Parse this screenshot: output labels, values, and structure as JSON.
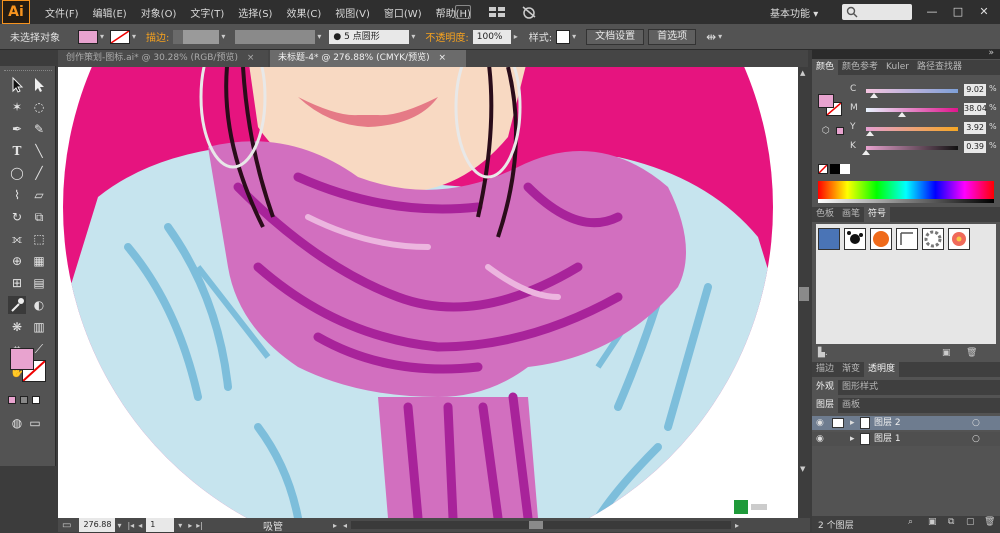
{
  "app": {
    "logo": "Ai"
  },
  "menu": [
    "文件(F)",
    "编辑(E)",
    "对象(O)",
    "文字(T)",
    "选择(S)",
    "效果(C)",
    "视图(V)",
    "窗口(W)",
    "帮助(H)"
  ],
  "workspace": {
    "label": "基本功能",
    "arrow": "▾"
  },
  "window_controls": {
    "minimize": "—",
    "restore": "□",
    "close": "✕"
  },
  "control_bar": {
    "selection_status": "未选择对象",
    "fill_color": "#e8a3cf",
    "stroke_label": "描边:",
    "brush_label": "5 点圆形",
    "opacity_label": "不透明度:",
    "opacity_value": "100%",
    "style_label": "样式:",
    "doc_setup_button": "文档设置",
    "preferences_button": "首选项"
  },
  "tabs": [
    {
      "label": "创作策划-图标.ai* @ 30.28% (RGB/预览)",
      "close": "×"
    },
    {
      "label": "未标题-4* @ 276.88% (CMYK/预览)",
      "close": "×"
    }
  ],
  "status_bar": {
    "zoom": "276.88",
    "page": "1",
    "tool_name": "吸管"
  },
  "color_panel": {
    "tabs": [
      "颜色",
      "颜色参考",
      "Kuler",
      "路径查找器"
    ],
    "sliders": [
      {
        "letter": "C",
        "value": "9.02",
        "fraction": 0.09
      },
      {
        "letter": "M",
        "value": "38.04",
        "fraction": 0.38
      },
      {
        "letter": "Y",
        "value": "3.92",
        "fraction": 0.04
      },
      {
        "letter": "K",
        "value": "0.39",
        "fraction": 0.004
      }
    ],
    "pct": "%"
  },
  "symbols_panel": {
    "tabs": [
      "色板",
      "画笔",
      "符号"
    ]
  },
  "transparency_panel": {
    "tabs": [
      "描边",
      "渐变",
      "透明度"
    ]
  },
  "appearance_panel": {
    "tabs": [
      "外观",
      "图形样式"
    ]
  },
  "layers_panel": {
    "tabs": [
      "图层",
      "画板"
    ],
    "layers": [
      {
        "name": "图层 2"
      },
      {
        "name": "图层 1"
      }
    ],
    "footer_count": "2 个图层"
  },
  "colors": {
    "magenta_bg": "#e6147f",
    "scarf_pink": "#d26fbf",
    "scarf_dark": "#a8239a",
    "coat": "#c6e4ee",
    "coat_line": "#7dbedb",
    "skin": "#f8d9c2",
    "lips": "#e57a86"
  }
}
